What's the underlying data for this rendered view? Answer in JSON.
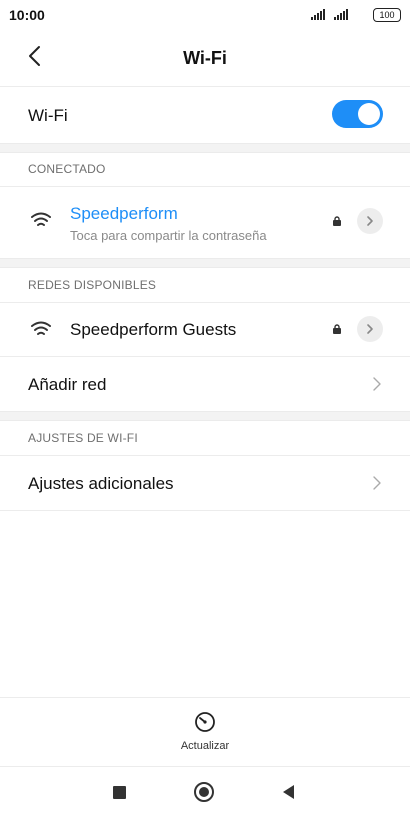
{
  "status_bar": {
    "time": "10:00",
    "battery": "100",
    "icons": [
      "signal-icon",
      "signal-icon",
      "battery-icon"
    ]
  },
  "app_bar": {
    "title": "Wi-Fi",
    "back_icon": "back-arrow-icon"
  },
  "wifi_toggle": {
    "label": "Wi-Fi",
    "state": "on",
    "accent_color": "#1e8ef7"
  },
  "connected": {
    "section_title": "CONECTADO",
    "network": {
      "name": "Speedperform",
      "subtitle": "Toca para compartir la contraseña",
      "name_color": "#1e8ef7",
      "icons": [
        "wifi-icon",
        "lock-icon",
        "chevron-right-icon"
      ]
    }
  },
  "available": {
    "section_title": "REDES DISPONIBLES",
    "networks": [
      {
        "name": "Speedperform Guests",
        "icons": [
          "wifi-icon",
          "lock-icon",
          "chevron-right-icon"
        ]
      }
    ],
    "add_network": "Añadir red"
  },
  "wifi_settings": {
    "section_title": "AJUSTES DE WI-FI",
    "additional": "Ajustes adicionales"
  },
  "bottom_action": {
    "label": "Actualizar",
    "icon": "refresh-icon"
  },
  "nav_bar": {
    "icons": [
      "recents-square-icon",
      "home-circle-icon",
      "back-triangle-icon"
    ]
  }
}
